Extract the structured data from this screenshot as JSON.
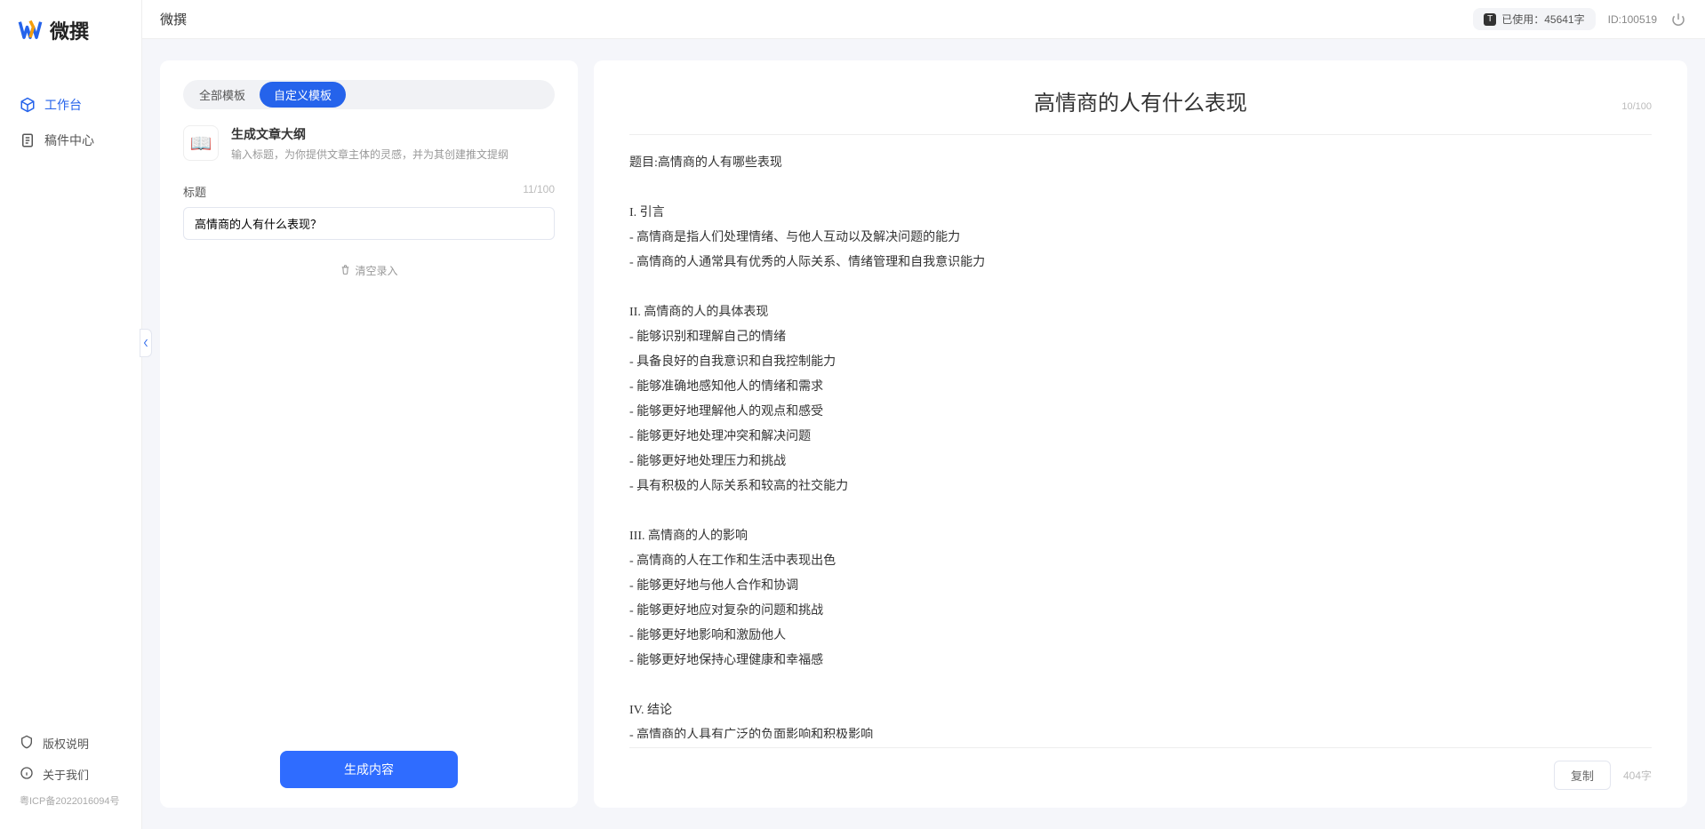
{
  "app": {
    "brand": "微撰",
    "topbar_title": "微撰",
    "usage_label": "已使用：45641字",
    "user_id_label": "ID:100519"
  },
  "sidebar": {
    "nav": [
      {
        "label": "工作台",
        "active": true,
        "icon": "cube"
      },
      {
        "label": "稿件中心",
        "active": false,
        "icon": "doc"
      }
    ],
    "footer": [
      {
        "label": "版权说明",
        "icon": "shield"
      },
      {
        "label": "关于我们",
        "icon": "info"
      }
    ],
    "icp": "粤ICP备2022016094号"
  },
  "left": {
    "tabs": [
      {
        "label": "全部模板",
        "active": false
      },
      {
        "label": "自定义模板",
        "active": true
      }
    ],
    "template": {
      "title": "生成文章大纲",
      "desc": "输入标题，为你提供文章主体的灵感，并为其创建推文提纲"
    },
    "field": {
      "label": "标题",
      "count": "11/100",
      "value": "高情商的人有什么表现？"
    },
    "clear_label": "清空录入",
    "generate_label": "生成内容"
  },
  "right": {
    "doc_title": "高情商的人有什么表现",
    "title_count": "10/100",
    "doc_body": "题目:高情商的人有哪些表现\n\nI. 引言\n- 高情商是指人们处理情绪、与他人互动以及解决问题的能力\n- 高情商的人通常具有优秀的人际关系、情绪管理和自我意识能力\n\nII. 高情商的人的具体表现\n- 能够识别和理解自己的情绪\n- 具备良好的自我意识和自我控制能力\n- 能够准确地感知他人的情绪和需求\n- 能够更好地理解他人的观点和感受\n- 能够更好地处理冲突和解决问题\n- 能够更好地处理压力和挑战\n- 具有积极的人际关系和较高的社交能力\n\nIII. 高情商的人的影响\n- 高情商的人在工作和生活中表现出色\n- 能够更好地与他人合作和协调\n- 能够更好地应对复杂的问题和挑战\n- 能够更好地影响和激励他人\n- 能够更好地保持心理健康和幸福感\n\nIV. 结论\n- 高情商的人具有广泛的负面影响和积极影响\n- 高情商的能力是可以通过学习和练习获得的\n- 培养和提高高情商的能力对于个人的职业发展和生活质量至关重要。",
    "copy_label": "复制",
    "char_count": "404字"
  }
}
